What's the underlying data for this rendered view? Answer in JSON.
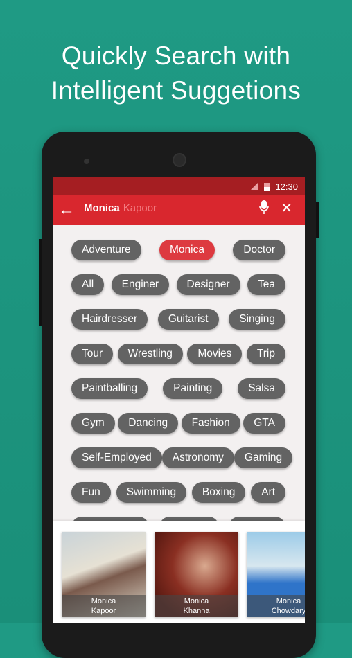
{
  "headline": {
    "line1": "Quickly Search with",
    "line2": "Intelligent Suggetions"
  },
  "status": {
    "time": "12:30",
    "icons": [
      "signal-icon",
      "battery-icon"
    ]
  },
  "toolbar": {
    "query": "Monica",
    "suggestion": "Kapoor",
    "icons": [
      "back-arrow-icon",
      "mic-icon",
      "close-icon"
    ]
  },
  "colors": {
    "background": "#1f9a84",
    "status_bar": "#a51e22",
    "toolbar": "#d9272e",
    "tag": "#636363",
    "tag_active": "#dd3a40"
  },
  "tags": [
    [
      "Adventure",
      "Monica",
      "Doctor"
    ],
    [
      "All",
      "Enginer",
      "Designer",
      "Tea"
    ],
    [
      "Hairdresser",
      "Guitarist",
      "Singing"
    ],
    [
      "Tour",
      "Wrestling",
      "Movies",
      "Trip"
    ],
    [
      "Paintballing",
      "Painting",
      "Salsa"
    ],
    [
      "Gym",
      "Dancing",
      "Fashion",
      "GTA"
    ],
    [
      "Self-Employed",
      "Astronomy",
      "Gaming"
    ],
    [
      "Fun",
      "Swimming",
      "Boxing",
      "Art"
    ],
    [
      "",
      "",
      ""
    ]
  ],
  "active_tag": "Monica",
  "results": [
    {
      "first": "Monica",
      "last": "Kapoor"
    },
    {
      "first": "Monica",
      "last": "Khanna"
    },
    {
      "first": "Monica",
      "last": "Chowdary"
    }
  ]
}
